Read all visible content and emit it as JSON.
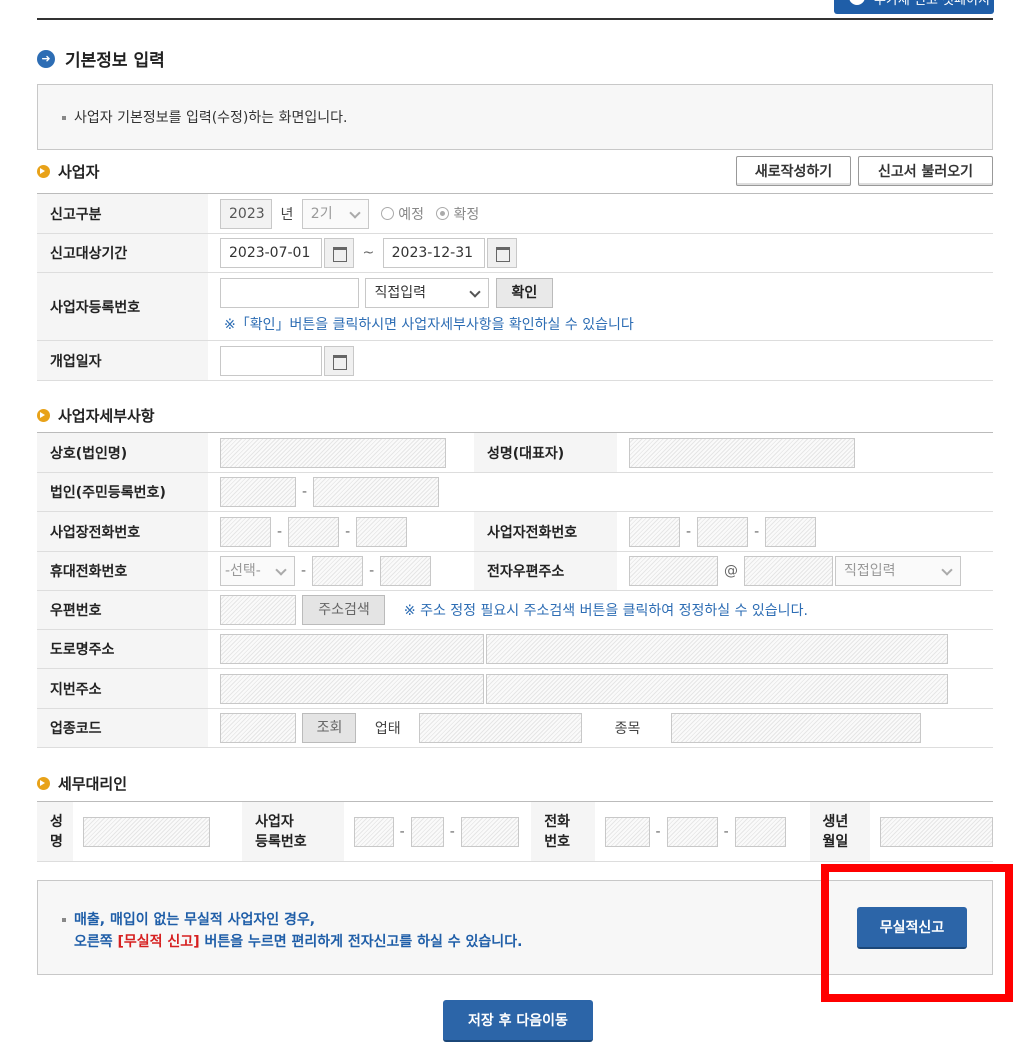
{
  "top_button": {
    "label": "부가세 신고 첫페이지"
  },
  "page_title": "기본정보 입력",
  "info_text": "사업자 기본정보를 입력(수정)하는 화면입니다.",
  "sections": {
    "business": "사업자",
    "details": "사업자세부사항",
    "agent": "세무대리인"
  },
  "actions": {
    "new": "새로작성하기",
    "load": "신고서 불러오기",
    "no_activity": "무실적신고",
    "save_next": "저장 후 다음이동"
  },
  "business": {
    "report_type_label": "신고구분",
    "year": "2023",
    "year_suffix": "년",
    "period": "2기",
    "radio_planned": "예정",
    "radio_final": "확정",
    "period_label": "신고대상기간",
    "start_date": "2023-07-01",
    "tilde": "~",
    "end_date": "2023-12-31",
    "reg_no_label": "사업자등록번호",
    "input_mode": "직접입력",
    "confirm": "확인",
    "reg_note": "※「확인」버튼을 클릭하시면 사업자세부사항을 확인하실 수 있습니다",
    "open_date_label": "개업일자"
  },
  "details": {
    "company_name": "상호(법인명)",
    "rep_name": "성명(대표자)",
    "corp_no": "법인(주민등록번호)",
    "workplace_phone": "사업장전화번호",
    "business_phone": "사업자전화번호",
    "mobile": "휴대전화번호",
    "mobile_select": "-선택-",
    "email": "전자우편주소",
    "at": "@",
    "email_domain": "직접입력",
    "zip": "우편번호",
    "addr_search": "주소검색",
    "zip_note": "※ 주소 정정 필요시 주소검색 버튼을 클릭하여 정정하실 수 있습니다.",
    "road_addr": "도로명주소",
    "lot_addr": "지번주소",
    "biz_code": "업종코드",
    "lookup": "조회",
    "biz_type": "업태",
    "biz_item": "종목",
    "dash": "-"
  },
  "agent": {
    "name": "성명",
    "reg_no": "사업자\n등록번호",
    "phone": "전화\n번호",
    "birth": "생년\n월일"
  },
  "bottom": {
    "line1": "매출, 매입이 없는 무실적 사업자인 경우,",
    "line2_a": "오른쪽 ",
    "line2_red": "[무실적 신고]",
    "line2_b": " 버튼을 누르면 편리하게 전자신고를 하실 수 있습니다."
  },
  "colors": {
    "accent_blue": "#2c65a8",
    "highlight_red": "#ff0000",
    "bullet_orange": "#e8a219"
  }
}
